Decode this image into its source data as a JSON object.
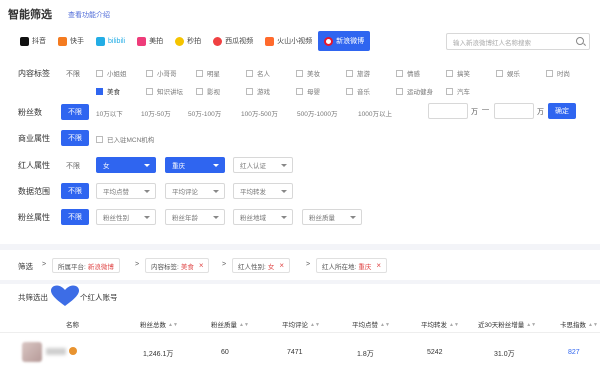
{
  "header": {
    "title": "智能筛选",
    "subtitle": "查看功能介绍"
  },
  "platforms": [
    {
      "label": "抖音",
      "icon": "douyin-icon",
      "color": "#111111",
      "active": false
    },
    {
      "label": "快手",
      "icon": "kuaishou-icon",
      "color": "#f47b20",
      "active": false
    },
    {
      "label": "bilibili",
      "icon": "bilibili-icon",
      "color": "#23ade5",
      "active": false
    },
    {
      "label": "美拍",
      "icon": "meipai-icon",
      "color": "#ee3c7a",
      "active": false
    },
    {
      "label": "秒拍",
      "icon": "miaopai-icon",
      "color": "#f5c400",
      "active": false
    },
    {
      "label": "西瓜视频",
      "icon": "xigua-icon",
      "color": "#f04142",
      "active": false
    },
    {
      "label": "火山小视频",
      "icon": "huoshan-icon",
      "color": "#ff6a2c",
      "active": false
    },
    {
      "label": "新浪微博",
      "icon": "weibo-icon",
      "color": "#e6162d",
      "active": true
    }
  ],
  "search": {
    "placeholder": "输入新浪微博红人名称搜索"
  },
  "content_tags": {
    "label": "内容标签",
    "unlimited": "不限",
    "row1": [
      "小姐姐",
      "小哥哥",
      "明星",
      "名人",
      "美妆",
      "旅游",
      "情感",
      "搞笑",
      "娱乐",
      "时尚"
    ],
    "row2": [
      "美食",
      "知识讲坛",
      "影视",
      "游戏",
      "母婴",
      "音乐",
      "运动健身",
      "汽车"
    ],
    "checked": "美食"
  },
  "fans": {
    "label": "粉丝数",
    "unlimited": "不限",
    "options": [
      "10万以下",
      "10万-50万",
      "50万-100万",
      "100万-500万",
      "500万-1000万",
      "1000万以上"
    ],
    "unit": "万",
    "dash": "—",
    "confirm": "确定"
  },
  "business": {
    "label": "商业属性",
    "unlimited": "不限",
    "option": "已入驻MCN机构"
  },
  "influencer": {
    "label": "红人属性",
    "unlimited": "不限",
    "gender": "女",
    "region": "重庆",
    "cert": "红人认证"
  },
  "data_range": {
    "label": "数据范围",
    "unlimited": "不限",
    "options": [
      "平均点赞",
      "平均评论",
      "平均转发"
    ]
  },
  "fan_attr": {
    "label": "粉丝属性",
    "unlimited": "不限",
    "options": [
      "粉丝性别",
      "粉丝年龄",
      "粉丝地域",
      "粉丝质量"
    ]
  },
  "filterbar": {
    "label": "筛选",
    "arrow": ">",
    "close": "×",
    "chips": [
      {
        "key": "所属平台:",
        "value": "新浪微博"
      },
      {
        "key": "内容标签:",
        "value": "美食"
      },
      {
        "key": "红人性别:",
        "value": "女"
      },
      {
        "key": "红人所在地:",
        "value": "重庆"
      }
    ]
  },
  "results": {
    "prefix": "共筛选出",
    "suffix": "个红人账号",
    "columns": [
      "名称",
      "粉丝总数",
      "粉丝质量",
      "平均评论",
      "平均点赞",
      "平均转发",
      "近30天粉丝增量",
      "卡思指数"
    ],
    "sort_icon": "▲▼",
    "row": {
      "fans_total": "1,246.1万",
      "fan_quality": "60",
      "avg_comments": "7471",
      "avg_likes": "1.8万",
      "avg_reposts": "5242",
      "fans_growth_30d": "31.0万",
      "index": "827"
    }
  },
  "colors": {
    "accent": "#2f65f0",
    "danger": "#e04848"
  }
}
